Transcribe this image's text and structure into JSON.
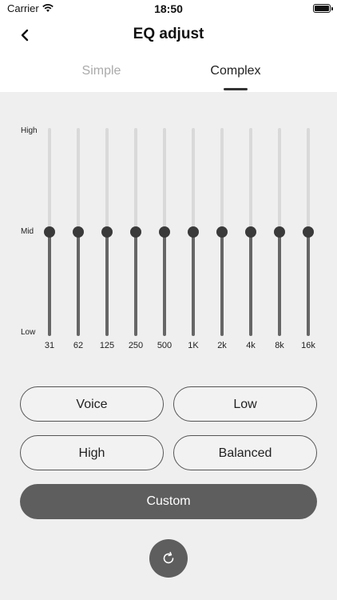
{
  "status_bar": {
    "carrier": "Carrier",
    "time": "18:50"
  },
  "nav": {
    "title": "EQ adjust"
  },
  "tabs": {
    "simple": "Simple",
    "complex": "Complex",
    "selected": "Complex"
  },
  "eq": {
    "levels": {
      "high": "High",
      "mid": "Mid",
      "low": "Low"
    },
    "bands": [
      {
        "freq": "31",
        "value": 0.5
      },
      {
        "freq": "62",
        "value": 0.5
      },
      {
        "freq": "125",
        "value": 0.5
      },
      {
        "freq": "250",
        "value": 0.5
      },
      {
        "freq": "500",
        "value": 0.5
      },
      {
        "freq": "1K",
        "value": 0.5
      },
      {
        "freq": "2k",
        "value": 0.5
      },
      {
        "freq": "4k",
        "value": 0.5
      },
      {
        "freq": "8k",
        "value": 0.5
      },
      {
        "freq": "16k",
        "value": 0.5
      }
    ]
  },
  "presets": {
    "voice": "Voice",
    "low": "Low",
    "high": "High",
    "balanced": "Balanced",
    "custom": "Custom"
  },
  "icons": {
    "back": "chevron-left-icon",
    "reset": "refresh-icon",
    "wifi": "wifi-icon",
    "battery": "battery-icon"
  },
  "colors": {
    "panel": "#efefef",
    "track": "#d9d9d9",
    "fill": "#666666",
    "thumb": "#3a3a3a",
    "button_dark": "#5e5e5e"
  }
}
